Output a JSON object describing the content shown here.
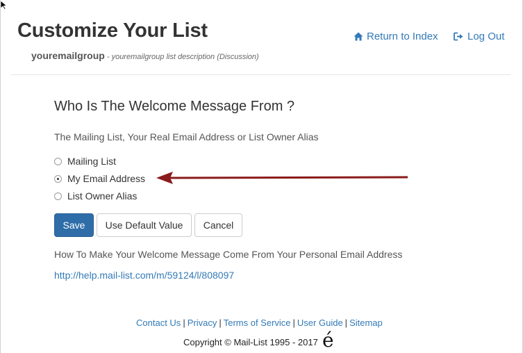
{
  "header": {
    "title": "Customize Your List",
    "group_name": "youremailgroup",
    "group_description": " - youremailgroup list description (Discussion)"
  },
  "nav": {
    "return_label": "Return to Index",
    "logout_label": "Log Out"
  },
  "question": {
    "heading": "Who Is The Welcome Message From ?",
    "help": "The Mailing List, Your Real Email Address or List Owner Alias"
  },
  "options": [
    {
      "label": "Mailing List",
      "checked": false
    },
    {
      "label": "My Email Address",
      "checked": true
    },
    {
      "label": "List Owner Alias",
      "checked": false
    }
  ],
  "buttons": {
    "save": "Save",
    "default": "Use Default Value",
    "cancel": "Cancel"
  },
  "how_to": "How To Make Your Welcome Message Come From Your Personal Email Address",
  "help_link": "http://help.mail-list.com/m/59124/l/808097",
  "footer": {
    "links": [
      "Contact Us",
      "Privacy",
      "Terms of Service",
      "User Guide",
      "Sitemap"
    ],
    "separator": "|",
    "copyright": "Copyright © Mail-List 1995 - 2017",
    "logo_glyph": "é"
  },
  "colors": {
    "link": "#337ab7",
    "primary_button": "#2f6da8",
    "annotation_arrow": "#8b1a1a"
  }
}
